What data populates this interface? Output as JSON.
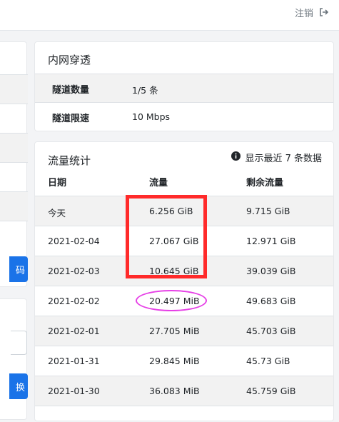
{
  "header": {
    "logout_label": "注销",
    "logout_icon": "sign-out-icon"
  },
  "left_partial": {
    "button1_label": "码",
    "button2_label": "换"
  },
  "tunnel": {
    "title": "内网穿透",
    "rows": [
      {
        "label": "隧道数量",
        "value": "1/5 条"
      },
      {
        "label": "隧道限速",
        "value": "10 Mbps"
      }
    ]
  },
  "traffic": {
    "title": "流量统计",
    "recent_note": "显示最近 7 条数据",
    "columns": [
      "日期",
      "流量",
      "剩余流量"
    ],
    "rows": [
      {
        "date": "今天",
        "usage": "6.256 GiB",
        "remaining": "9.715 GiB"
      },
      {
        "date": "2021-02-04",
        "usage": "27.067 GiB",
        "remaining": "12.971 GiB"
      },
      {
        "date": "2021-02-03",
        "usage": "10.645 GiB",
        "remaining": "39.039 GiB"
      },
      {
        "date": "2021-02-02",
        "usage": "20.497 MiB",
        "remaining": "49.683 GiB"
      },
      {
        "date": "2021-02-01",
        "usage": "27.705 MiB",
        "remaining": "45.703 GiB"
      },
      {
        "date": "2021-01-31",
        "usage": "29.845 MiB",
        "remaining": "45.73 GiB"
      },
      {
        "date": "2021-01-30",
        "usage": "36.083 MiB",
        "remaining": "45.759 GiB"
      }
    ]
  },
  "colors": {
    "accent": "#1a73e8",
    "annotation_rect": "#ff2a2a",
    "annotation_ellipse": "#e640e6"
  }
}
